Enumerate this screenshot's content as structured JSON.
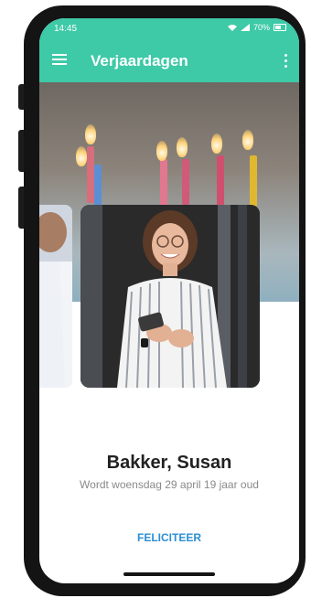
{
  "status_bar": {
    "time": "14:45",
    "battery_text": "70%"
  },
  "app_bar": {
    "title": "Verjaardagen"
  },
  "person": {
    "name": "Bakker, Susan",
    "birthday_text": "Wordt woensdag 29 april 19 jaar oud"
  },
  "actions": {
    "congratulate_label": "FELICITEER"
  },
  "colors": {
    "accent": "#3ec9a7",
    "link": "#2a8fd6",
    "name_text": "#222222",
    "subtext": "#8a8a8a"
  },
  "icons": [
    "menu-icon",
    "more-vert-icon",
    "wifi-icon",
    "signal-icon",
    "battery-icon"
  ]
}
